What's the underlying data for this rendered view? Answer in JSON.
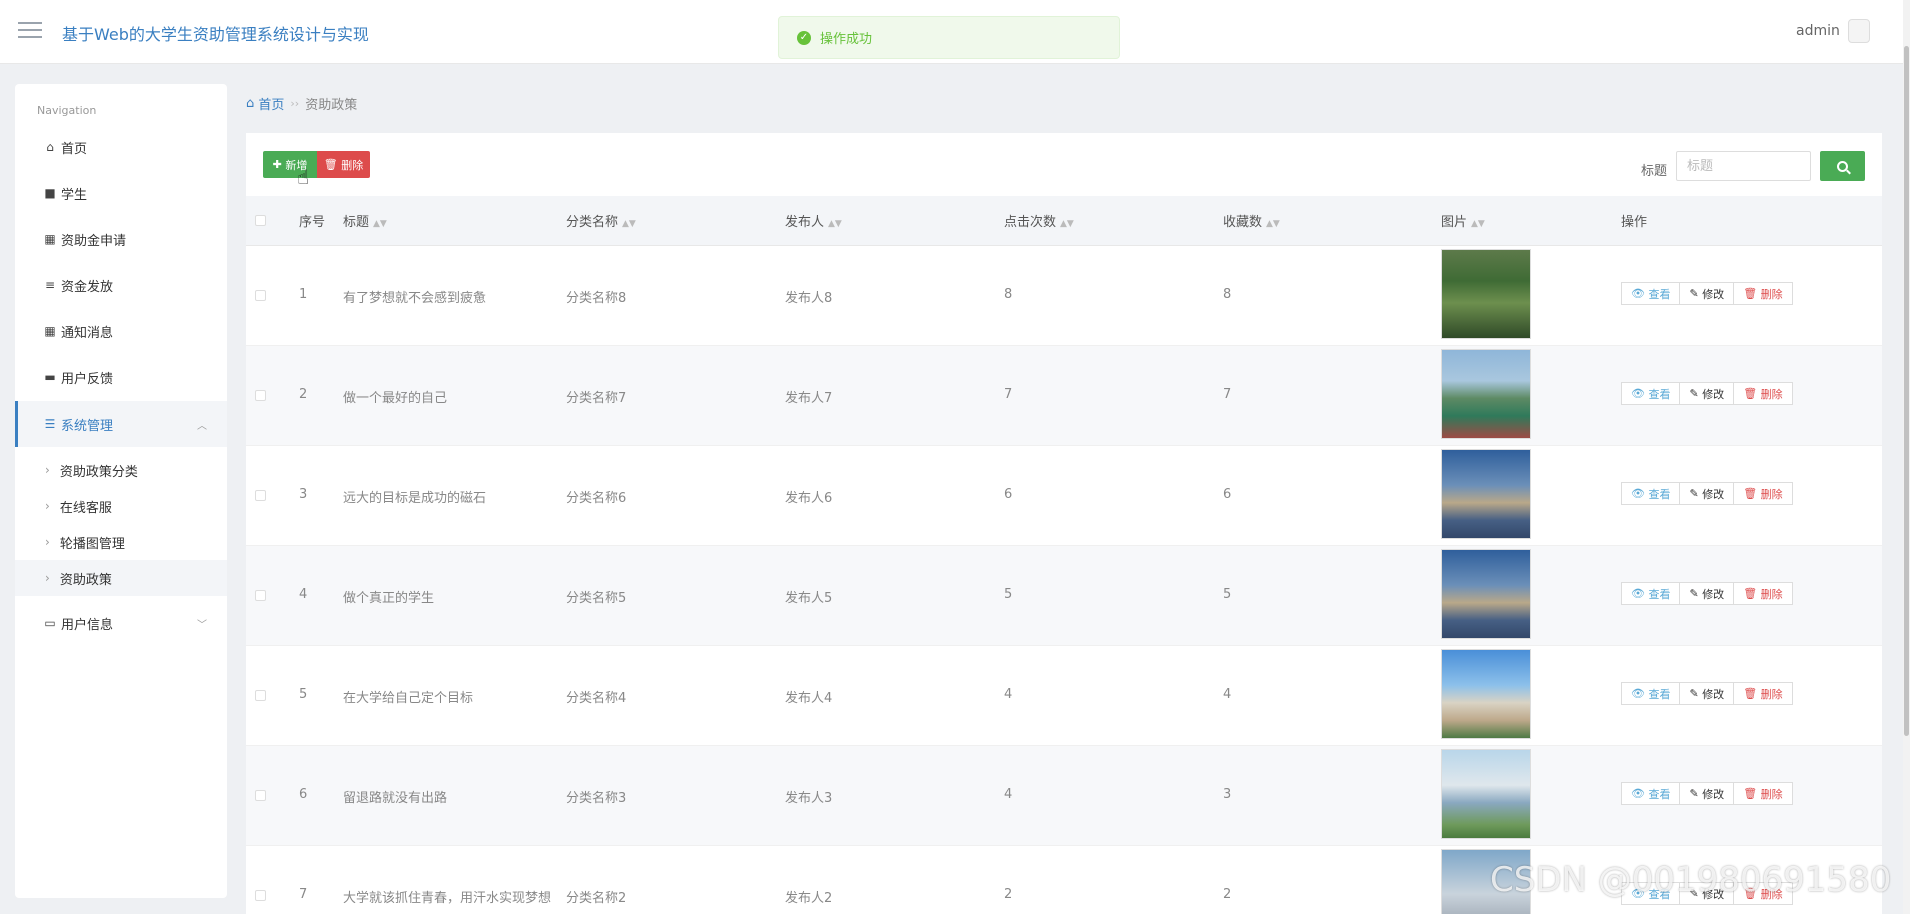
{
  "header": {
    "title": "基于Web的大学生资助管理系统设计与实现",
    "user": "admin",
    "toast": "操作成功"
  },
  "sidebar": {
    "title": "Navigation",
    "items": [
      {
        "label": "首页",
        "icon": "home-icon"
      },
      {
        "label": "学生",
        "icon": "briefcase-icon"
      },
      {
        "label": "资助金申请",
        "icon": "grid-icon"
      },
      {
        "label": "资金发放",
        "icon": "sliders-icon"
      },
      {
        "label": "通知消息",
        "icon": "grid-icon"
      },
      {
        "label": "用户反馈",
        "icon": "print-icon"
      },
      {
        "label": "系统管理",
        "icon": "list-icon"
      },
      {
        "label": "用户信息",
        "icon": "card-icon"
      }
    ],
    "subitems": [
      "资助政策分类",
      "在线客服",
      "轮播图管理",
      "资助政策"
    ]
  },
  "breadcrumb": {
    "home": "首页",
    "separator": "›› ",
    "current": "资助政策"
  },
  "toolbar": {
    "add_label": "新增",
    "delete_label": "删除",
    "search_label": "标题",
    "search_placeholder": "标题"
  },
  "table": {
    "columns": [
      "序号",
      "标题",
      "分类名称",
      "发布人",
      "点击次数",
      "收藏数",
      "图片",
      "操作"
    ],
    "actions": {
      "view": "查看",
      "edit": "修改",
      "delete": "删除"
    },
    "rows": [
      {
        "no": "1",
        "title": "有了梦想就不会感到疲惫",
        "category": "分类名称8",
        "publisher": "发布人8",
        "clicks": "8",
        "favorites": "8",
        "image": "campus-garden"
      },
      {
        "no": "2",
        "title": "做一个最好的自己",
        "category": "分类名称7",
        "publisher": "发布人7",
        "clicks": "7",
        "favorites": "7",
        "image": "sports-track"
      },
      {
        "no": "3",
        "title": "远大的目标是成功的磁石",
        "category": "分类名称6",
        "publisher": "发布人6",
        "clicks": "6",
        "favorites": "6",
        "image": "school-building"
      },
      {
        "no": "4",
        "title": "做个真正的学生",
        "category": "分类名称5",
        "publisher": "发布人5",
        "clicks": "5",
        "favorites": "5",
        "image": "school-building"
      },
      {
        "no": "5",
        "title": "在大学给自己定个目标",
        "category": "分类名称4",
        "publisher": "发布人4",
        "clicks": "4",
        "favorites": "4",
        "image": "dormitory"
      },
      {
        "no": "6",
        "title": "留退路就没有出路",
        "category": "分类名称3",
        "publisher": "发布人3",
        "clicks": "4",
        "favorites": "3",
        "image": "library"
      },
      {
        "no": "7",
        "title": "大学就该抓住青春，用汗水实现梦想",
        "category": "分类名称2",
        "publisher": "发布人2",
        "clicks": "2",
        "favorites": "2",
        "image": "teaching-block"
      }
    ]
  },
  "watermark": "CSDN @001980691580",
  "colors": {
    "accent": "#3a7fc1",
    "success": "#4aab55",
    "danger": "#dd4b4b"
  }
}
